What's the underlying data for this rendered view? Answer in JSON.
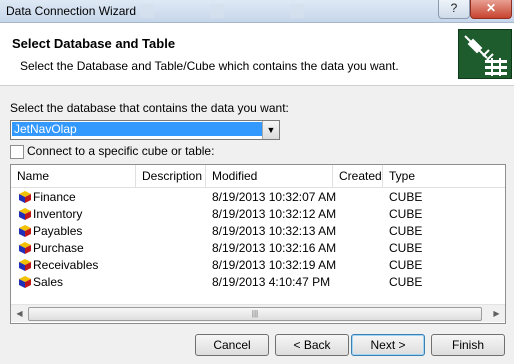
{
  "window": {
    "title": "Data Connection Wizard",
    "help_label": "?",
    "close_label": "✕"
  },
  "header": {
    "title": "Select Database and Table",
    "subtitle": "Select the Database and Table/Cube which contains the data you want."
  },
  "database": {
    "label": "Select the database that contains the data you want:",
    "selected": "JetNavOlap"
  },
  "connect_specific": {
    "label": "Connect to a specific cube or table:",
    "checked": false
  },
  "table": {
    "columns": [
      "Name",
      "Description",
      "Modified",
      "Created",
      "Type"
    ],
    "rows": [
      {
        "name": "Finance",
        "description": "",
        "modified": "8/19/2013 10:32:07 AM",
        "created": "",
        "type": "CUBE"
      },
      {
        "name": "Inventory",
        "description": "",
        "modified": "8/19/2013 10:32:12 AM",
        "created": "",
        "type": "CUBE"
      },
      {
        "name": "Payables",
        "description": "",
        "modified": "8/19/2013 10:32:13 AM",
        "created": "",
        "type": "CUBE"
      },
      {
        "name": "Purchase",
        "description": "",
        "modified": "8/19/2013 10:32:16 AM",
        "created": "",
        "type": "CUBE"
      },
      {
        "name": "Receivables",
        "description": "",
        "modified": "8/19/2013 10:32:19 AM",
        "created": "",
        "type": "CUBE"
      },
      {
        "name": "Sales",
        "description": "",
        "modified": "8/19/2013 4:10:47 PM",
        "created": "",
        "type": "CUBE"
      }
    ],
    "row_icon": "cube-icon"
  },
  "buttons": {
    "cancel": "Cancel",
    "back": "< Back",
    "next": "Next >",
    "finish": "Finish"
  },
  "colors": {
    "selection": "#3399ff",
    "logo_bg": "#1e5c2e"
  }
}
